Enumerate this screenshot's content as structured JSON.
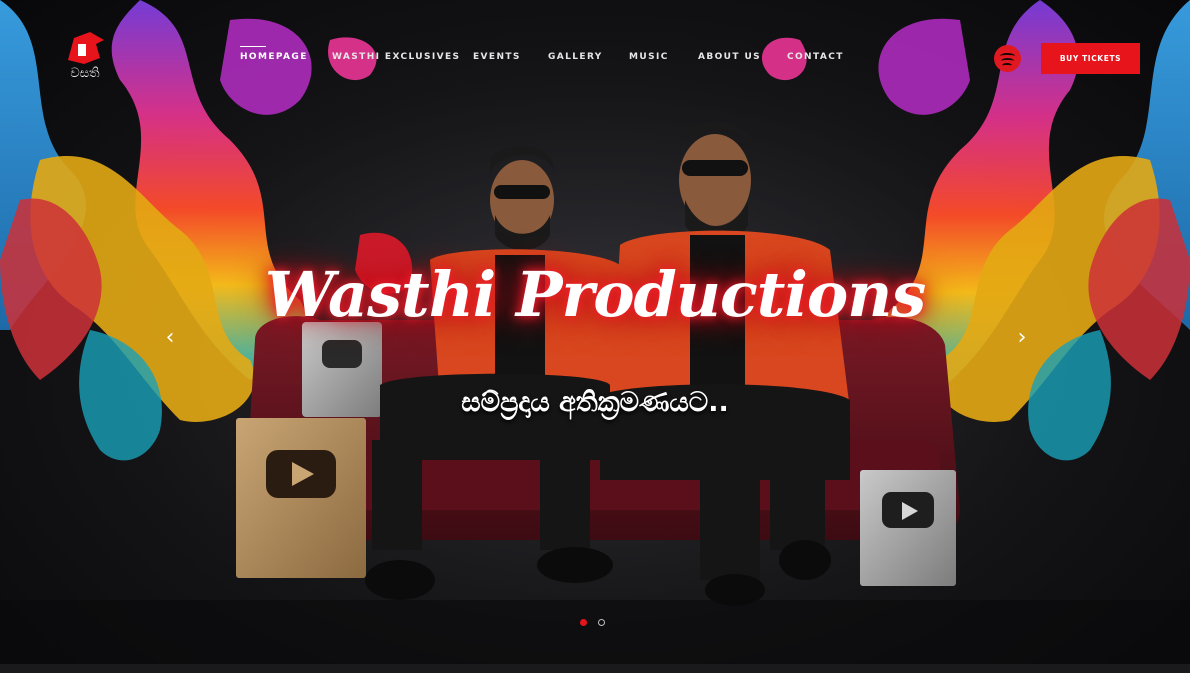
{
  "brand": {
    "logo_text": "වසති",
    "accent_color": "#e8141c"
  },
  "nav": {
    "items": [
      {
        "label": "HOMEPAGE",
        "active": true
      },
      {
        "label": "WASTHI EXCLUSIVES",
        "active": false
      },
      {
        "label": "EVENTS",
        "active": false
      },
      {
        "label": "GALLERY",
        "active": false
      },
      {
        "label": "MUSIC",
        "active": false
      },
      {
        "label": "ABOUT US",
        "active": false
      },
      {
        "label": "CONTACT",
        "active": false
      }
    ],
    "spotify_icon": "spotify-icon",
    "cta_label": "BUY TICKETS"
  },
  "hero": {
    "title": "Wasthi Productions",
    "subtitle": "සම්ප්‍රදාය අතික්‍රමණයට..",
    "prev_icon": "‹",
    "next_icon": "›",
    "slide_count": 2,
    "active_slide": 1
  }
}
